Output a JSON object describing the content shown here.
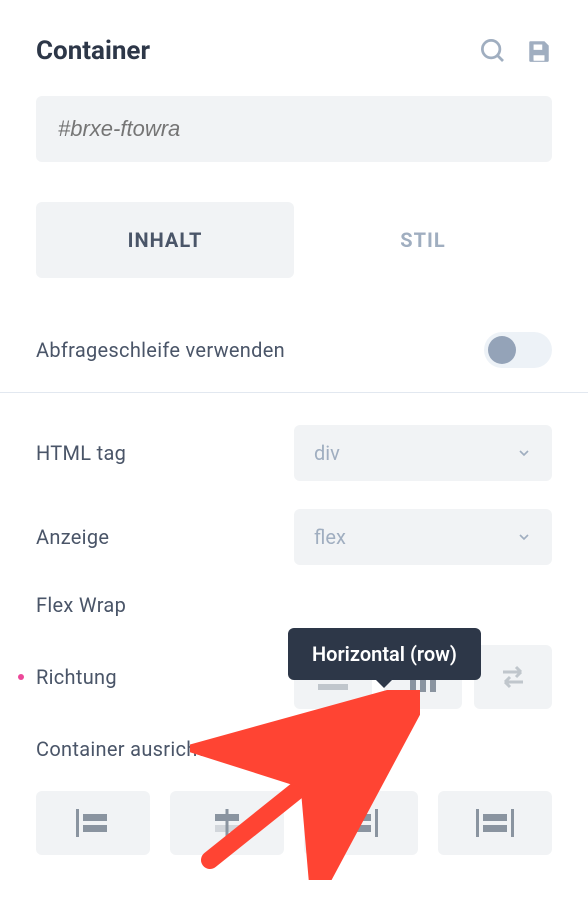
{
  "header": {
    "title": "Container"
  },
  "selector": {
    "placeholder": "#brxe-ftowra"
  },
  "tabs": {
    "content": "INHALT",
    "style": "STIL"
  },
  "controls": {
    "query_loop_label": "Abfrageschleife verwenden",
    "html_tag_label": "HTML tag",
    "html_tag_value": "div",
    "display_label": "Anzeige",
    "display_value": "flex",
    "flex_wrap_label": "Flex Wrap",
    "direction_label": "Richtung",
    "align_container_label": "Container ausrichten"
  },
  "tooltip": {
    "direction_row": "Horizontal (row)"
  }
}
